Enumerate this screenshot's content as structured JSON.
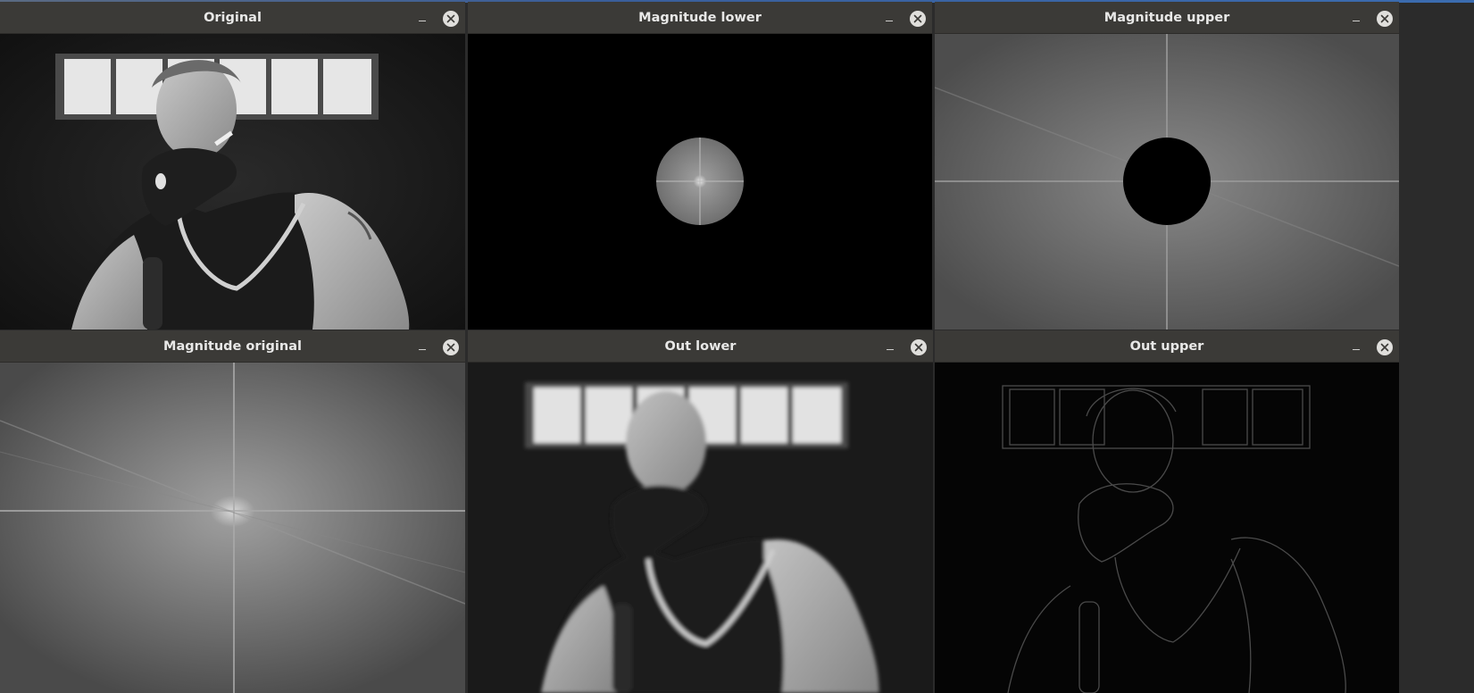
{
  "windows": [
    {
      "title": "Original"
    },
    {
      "title": "Magnitude lower"
    },
    {
      "title": "Magnitude upper"
    },
    {
      "title": "Magnitude original"
    },
    {
      "title": "Out lower"
    },
    {
      "title": "Out upper"
    }
  ],
  "icons": {
    "minimize": "minimize-icon",
    "close": "close-icon"
  },
  "colors": {
    "titlebar": "#3b3a37",
    "title_text": "#e8e8e7",
    "close_bg": "#e0dfdc"
  }
}
